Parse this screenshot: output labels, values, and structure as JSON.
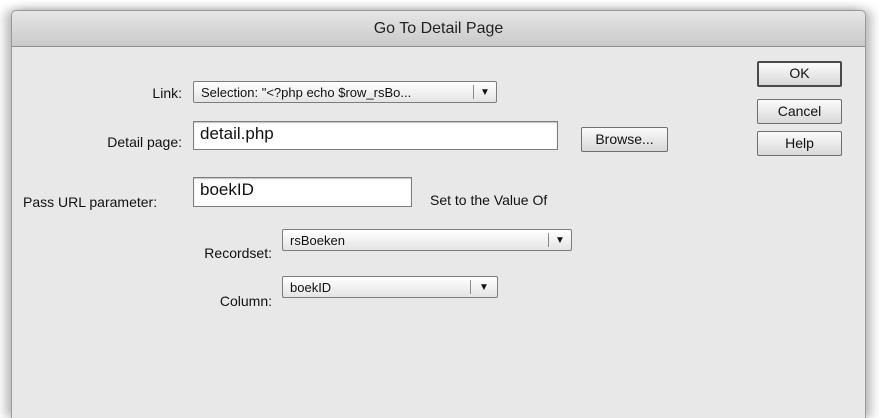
{
  "window": {
    "title": "Go To Detail Page"
  },
  "form": {
    "link": {
      "label": "Link:",
      "value": "Selection: \"<?php echo $row_rsBo...",
      "arrow_icon": "triangle-down"
    },
    "detail_page": {
      "label": "Detail page:",
      "value": "detail.php",
      "browse_label": "Browse..."
    },
    "pass_url": {
      "label": "Pass URL parameter:",
      "value": "boekID",
      "set_label": "Set to the Value Of"
    },
    "recordset": {
      "label": "Recordset:",
      "value": "rsBoeken"
    },
    "column": {
      "label": "Column:",
      "value": "boekID"
    }
  },
  "buttons": {
    "ok": "OK",
    "cancel": "Cancel",
    "help": "Help"
  }
}
